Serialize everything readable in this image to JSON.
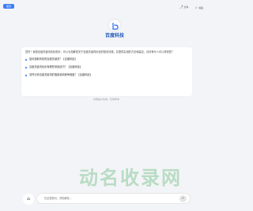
{
  "header": {
    "left_button": "首页",
    "actions": [
      {
        "icon": "share-icon",
        "label": "分享"
      },
      {
        "icon": "bookmark-icon",
        "label": "书签"
      }
    ]
  },
  "logo": {
    "text": "百度科技"
  },
  "chat": {
    "intro": "您好！我是百度关键词优化助手，可以为您解答关于百度关键词优化的相关问题，并提供实用的方法和建议。请问有什么可以帮到您？",
    "questions": [
      "如何选取有效的百度关键词？【百度科技】",
      "百度关键词优化有哪些常用技巧？【百度科技】",
      "怎样分析百度关键词的搜索量和竞争程度？【百度科技】"
    ],
    "disclaimer": "内容由AI生成，仅供参考"
  },
  "footer": {
    "menu_icon": "apps-icon",
    "input_placeholder": "在这里提问，帮您解答...",
    "send_icon": "send-icon"
  },
  "colors": {
    "accent": "#3d7ff3",
    "brand": "#1e58b8"
  }
}
